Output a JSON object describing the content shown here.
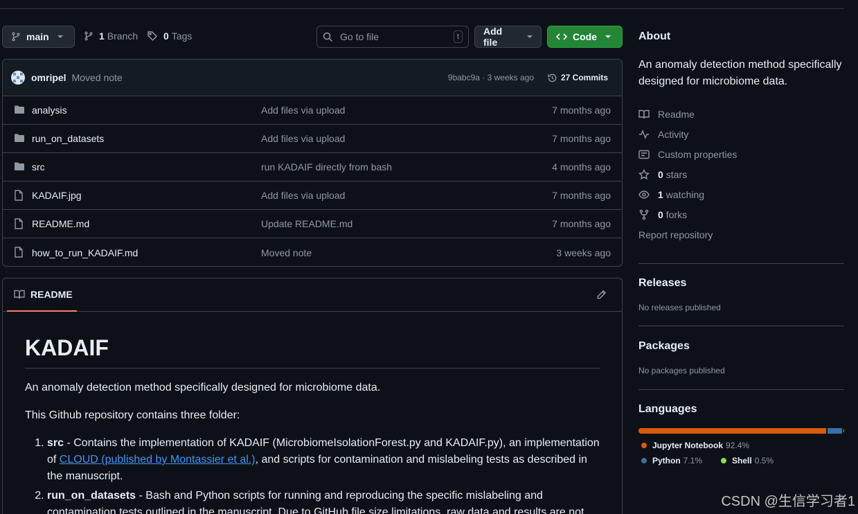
{
  "toolbar": {
    "branch_label": "main",
    "branches_count": "1",
    "branches_label": "Branch",
    "tags_count": "0",
    "tags_label": "Tags",
    "go_to_file_placeholder": "Go to file",
    "go_to_file_shortcut": "t",
    "add_file_label": "Add file",
    "code_label": "Code"
  },
  "commit": {
    "author": "omripel",
    "message": "Moved note",
    "hash_age": "9babc9a · 3 weeks ago",
    "commits_label": "27 Commits"
  },
  "files": [
    {
      "name": "analysis",
      "type": "folder",
      "message": "Add files via upload",
      "age": "7 months ago"
    },
    {
      "name": "run_on_datasets",
      "type": "folder",
      "message": "Add files via upload",
      "age": "7 months ago"
    },
    {
      "name": "src",
      "type": "folder",
      "message": "run KADAIF directly from bash",
      "age": "4 months ago"
    },
    {
      "name": "KADAIF.jpg",
      "type": "file",
      "message": "Add files via upload",
      "age": "7 months ago"
    },
    {
      "name": "README.md",
      "type": "file",
      "message": "Update README.md",
      "age": "7 months ago"
    },
    {
      "name": "how_to_run_KADAIF.md",
      "type": "file",
      "message": "Moved note",
      "age": "3 weeks ago"
    }
  ],
  "readme": {
    "tab_label": "README",
    "title": "KADAIF",
    "intro": "An anomaly detection method specifically designed for microbiome data.",
    "folders_intro": "This Github repository contains three folder:",
    "item1_name": "src",
    "item1_text_a": " - Contains the implementation of KADAIF (MicrobiomeIsolationForest.py and KADAIF.py), an implementation of ",
    "item1_link": "CLOUD (published by Montassier et al.)",
    "item1_text_b": ", and scripts for contamination and mislabeling tests as described in the manuscript.",
    "item2_name": "run_on_datasets",
    "item2_text": " - Bash and Python scripts for running and reproducing the specific mislabeling and contamination tests outlined in the manuscript. Due to GitHub file size limitations, raw data and results are not"
  },
  "about": {
    "title": "About",
    "description": "An anomaly detection method specifically designed for microbiome data.",
    "readme": "Readme",
    "activity": "Activity",
    "custom_properties": "Custom properties",
    "stars_count": "0",
    "stars_label": "stars",
    "watching_count": "1",
    "watching_label": "watching",
    "forks_count": "0",
    "forks_label": "forks",
    "report": "Report repository"
  },
  "releases": {
    "title": "Releases",
    "text": "No releases published"
  },
  "packages": {
    "title": "Packages",
    "text": "No packages published"
  },
  "languages": {
    "title": "Languages",
    "items": [
      {
        "name": "Jupyter Notebook",
        "percent": "92.4%",
        "value": 92.4,
        "color": "#DA5B0B"
      },
      {
        "name": "Python",
        "percent": "7.1%",
        "value": 7.1,
        "color": "#3572A5"
      },
      {
        "name": "Shell",
        "percent": "0.5%",
        "value": 0.5,
        "color": "#89e051"
      }
    ]
  },
  "colors": {
    "accent_green": "#238636",
    "link": "#4493f8",
    "tab_underline": "#f78166"
  },
  "watermark": "CSDN @生信学习者1"
}
